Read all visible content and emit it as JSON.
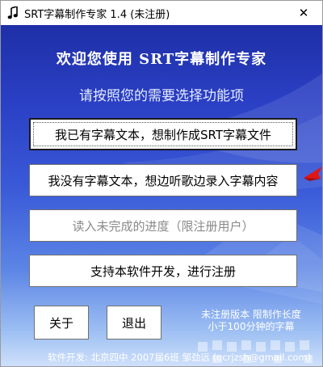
{
  "window": {
    "title": "SRT字幕制作专家 1.4 (未注册)",
    "close_symbol": "✕"
  },
  "main": {
    "heading": "欢迎您使用 SRT字幕制作专家",
    "subheading": "请按照您的需要选择功能项",
    "buttons": {
      "have_text": "我已有字幕文本，想制作成SRT字幕文件",
      "no_text": "我没有字幕文本，想边听歌边录入字幕内容",
      "load_progress": "读入未完成的进度（限注册用户）",
      "register": "支持本软件开发，进行注册",
      "about": "关于",
      "exit": "退出"
    },
    "note_line1": "未注册版本 限制作长度",
    "note_line2": "小于100分钟的字幕",
    "footer": "软件开发: 北京四中 2007届6班 邹劲远 (qcrjzsh@gmail.com)"
  },
  "icons": {
    "app": "music-note-icon",
    "close": "close-icon",
    "pointer": "red-arrow-icon"
  },
  "colors": {
    "accent_arrow": "#e01515",
    "background_top": "#1e2fa6",
    "background_bottom": "#cfe0fa"
  }
}
